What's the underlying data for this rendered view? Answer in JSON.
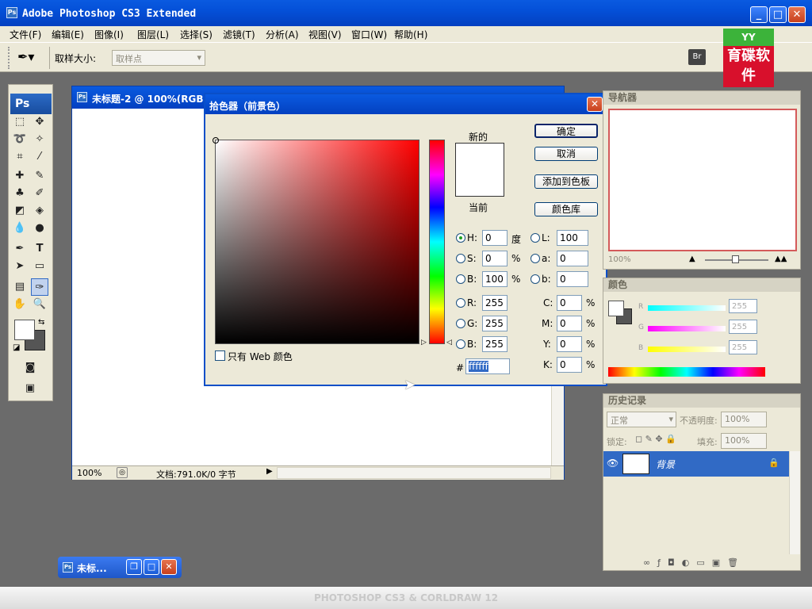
{
  "app": {
    "title": "Adobe Photoshop CS3 Extended",
    "ps_badge": "Ps"
  },
  "menu": [
    "文件(F)",
    "编辑(E)",
    "图像(I)",
    "图层(L)",
    "选择(S)",
    "滤镜(T)",
    "分析(A)",
    "视图(V)",
    "窗口(W)",
    "帮助(H)"
  ],
  "options": {
    "sample_size_label": "取样大小:",
    "sample_size_value": "取样点"
  },
  "logo": {
    "top": "YY",
    "text": "育碟软件"
  },
  "document": {
    "title": "未标题-2 @ 100%(RGB",
    "zoom": "100%",
    "doc_info": "文档:791.0K/0 字节"
  },
  "picker": {
    "title": "拾色器（前景色）",
    "new_label": "新的",
    "current_label": "当前",
    "ok": "确定",
    "cancel": "取消",
    "add_to_swatches": "添加到色板",
    "color_libraries": "颜色库",
    "web_only": "只有 Web 颜色",
    "H": {
      "label": "H:",
      "value": "0",
      "unit": "度"
    },
    "S": {
      "label": "S:",
      "value": "0",
      "unit": "%"
    },
    "Bri": {
      "label": "B:",
      "value": "100",
      "unit": "%"
    },
    "R": {
      "label": "R:",
      "value": "255"
    },
    "G": {
      "label": "G:",
      "value": "255"
    },
    "Blue": {
      "label": "B:",
      "value": "255"
    },
    "L": {
      "label": "L:",
      "value": "100"
    },
    "a": {
      "label": "a:",
      "value": "0"
    },
    "b": {
      "label": "b:",
      "value": "0"
    },
    "C": {
      "label": "C:",
      "value": "0",
      "unit": "%"
    },
    "M": {
      "label": "M:",
      "value": "0",
      "unit": "%"
    },
    "Y": {
      "label": "Y:",
      "value": "0",
      "unit": "%"
    },
    "K": {
      "label": "K:",
      "value": "0",
      "unit": "%"
    },
    "hex_label": "#",
    "hex_value": "ffffff"
  },
  "navigator": {
    "title": "导航器",
    "zoom": "100%"
  },
  "color_panel": {
    "title": "颜色",
    "r_label": "R",
    "g_label": "G",
    "b_label": "B",
    "r_value": "255",
    "g_value": "255",
    "b_value": "255"
  },
  "history": {
    "title": "历史记录"
  },
  "layers": {
    "blend_mode": "正常",
    "opacity_label": "不透明度:",
    "opacity_value": "100%",
    "lock_label": "锁定:",
    "fill_label": "填充:",
    "fill_value": "100%",
    "layer_name": "背景"
  },
  "taskbar_doc": {
    "title": "未标..."
  },
  "watermark": "PHOTOSHOP CS3 & CORLDRAW 12",
  "colors": {
    "titlebar": "#0450d8",
    "panel_bg": "#ece9d8",
    "workspace": "#6b6b6b",
    "selected_layer": "#316ac5"
  }
}
